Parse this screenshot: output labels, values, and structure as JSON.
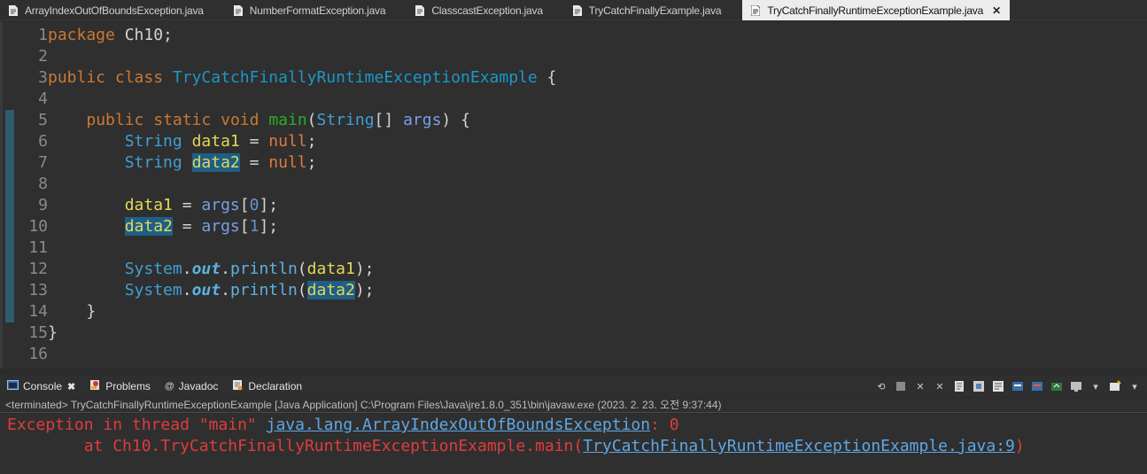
{
  "tabs": [
    {
      "label": "ArrayIndexOutOfBoundsException.java",
      "active": false
    },
    {
      "label": "NumberFormatException.java",
      "active": false
    },
    {
      "label": "ClasscastException.java",
      "active": false
    },
    {
      "label": "TryCatchFinallyExample.java",
      "active": false
    },
    {
      "label": "TryCatchFinallyRuntimeExceptionExample.java",
      "active": true
    }
  ],
  "editor": {
    "line_numbers": [
      "1",
      "2",
      "3",
      "4",
      "5",
      "6",
      "7",
      "8",
      "9",
      "10",
      "11",
      "12",
      "13",
      "14",
      "15",
      "16"
    ],
    "code": {
      "l1_kw": "package",
      "l1_rest": " Ch10;",
      "l3_kw1": "public",
      "l3_kw2": "class",
      "l3_name": "TryCatchFinallyRuntimeExceptionExample",
      "l3_brace": " {",
      "l5_public": "public",
      "l5_static": "static",
      "l5_void": "void",
      "l5_main": "main",
      "l5_paren": "(",
      "l5_string": "String",
      "l5_arr": "[] ",
      "l5_args": "args",
      "l5_end": ") {",
      "l6_type": "String",
      "l6_var": "data1",
      "l6_eq": " = ",
      "l6_null": "null",
      "l6_semi": ";",
      "l7_type": "String",
      "l7_var": "data2",
      "l7_eq": " = ",
      "l7_null": "null",
      "l7_semi": ";",
      "l9_var": "data1",
      "l9_eq": " = ",
      "l9_args": "args",
      "l9_o": "[",
      "l9_idx": "0",
      "l9_c": "];",
      "l10_var": "data2",
      "l10_eq": " = ",
      "l10_args": "args",
      "l10_o": "[",
      "l10_idx": "1",
      "l10_c": "];",
      "l12_sys": "System",
      "l12_dot1": ".",
      "l12_out": "out",
      "l12_dot2": ".",
      "l12_println": "println",
      "l12_o": "(",
      "l12_var": "data1",
      "l12_c": ");",
      "l13_sys": "System",
      "l13_dot1": ".",
      "l13_out": "out",
      "l13_dot2": ".",
      "l13_println": "println",
      "l13_o": "(",
      "l13_var": "data2",
      "l13_c": ");",
      "l14_brace": "}",
      "l15_brace": "}"
    }
  },
  "console_tabs": [
    {
      "label": "Console",
      "icon": "console-icon"
    },
    {
      "label": "Problems",
      "icon": "problems-icon"
    },
    {
      "label": "Javadoc",
      "icon": "javadoc-icon"
    },
    {
      "label": "Declaration",
      "icon": "declaration-icon"
    }
  ],
  "console": {
    "terminated": "<terminated> TryCatchFinallyRuntimeExceptionExample [Java Application] C:\\Program Files\\Java\\jre1.8.0_351\\bin\\javaw.exe (2023. 2. 23. 오전 9:37:44)",
    "line1_prefix": "Exception in thread \"main\" ",
    "line1_link": "java.lang.ArrayIndexOutOfBoundsException",
    "line1_suffix": ": 0",
    "line2_prefix": "        at Ch10.TryCatchFinallyRuntimeExceptionExample.main(",
    "line2_link": "TryCatchFinallyRuntimeExceptionExample.java:9",
    "line2_suffix": ")"
  },
  "colors": {
    "keyword": "#cc7832",
    "class_name": "#1c96c8",
    "variable": "#e6d65a",
    "error_text": "#e03c3c",
    "link": "#5fa7e6"
  }
}
